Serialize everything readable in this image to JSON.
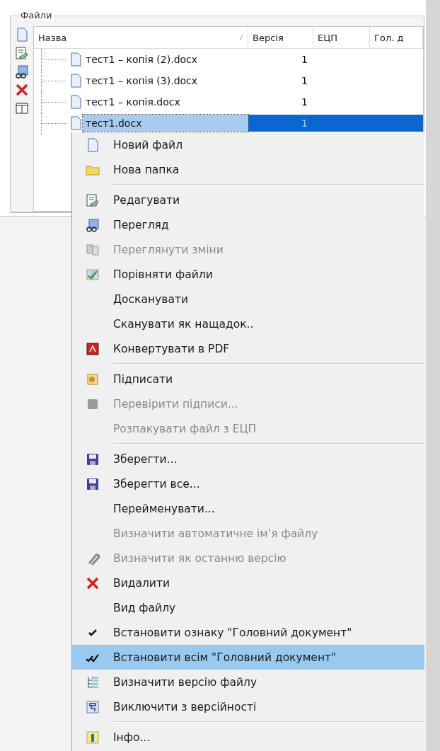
{
  "panel": {
    "title": "Файли"
  },
  "table": {
    "columns": [
      "Назва",
      "Версія",
      "ЕЦП",
      "Гол. д"
    ],
    "rows": [
      {
        "name": "тест1 – копія (2).docx",
        "version": "1",
        "selected": false
      },
      {
        "name": "тест1 – копія (3).docx",
        "version": "1",
        "selected": false
      },
      {
        "name": "тест1 – копія.docx",
        "version": "1",
        "selected": false
      },
      {
        "name": "тест1.docx",
        "version": "1",
        "selected": true
      }
    ]
  },
  "menu": {
    "groups": [
      [
        {
          "label": "Новий файл",
          "disabled": false,
          "selected": false
        },
        {
          "label": "Нова папка",
          "disabled": false,
          "selected": false
        }
      ],
      [
        {
          "label": "Редагувати",
          "disabled": false,
          "selected": false
        },
        {
          "label": "Перегляд",
          "disabled": false,
          "selected": false
        },
        {
          "label": "Переглянути зміни",
          "disabled": true,
          "selected": false
        },
        {
          "label": "Порівняти файли",
          "disabled": false,
          "selected": false
        },
        {
          "label": "Досканувати",
          "disabled": false,
          "selected": false
        },
        {
          "label": "Сканувати як нащадок..",
          "disabled": false,
          "selected": false
        },
        {
          "label": "Конвертувати в PDF",
          "disabled": false,
          "selected": false
        }
      ],
      [
        {
          "label": "Підписати",
          "disabled": false,
          "selected": false
        },
        {
          "label": "Перевірити підписи...",
          "disabled": true,
          "selected": false
        },
        {
          "label": "Розпакувати файл з ЕЦП",
          "disabled": true,
          "selected": false
        }
      ],
      [
        {
          "label": "Зберегти...",
          "disabled": false,
          "selected": false
        },
        {
          "label": "Зберегти все...",
          "disabled": false,
          "selected": false
        },
        {
          "label": "Перейменувати...",
          "disabled": false,
          "selected": false
        },
        {
          "label": "Визначити автоматичне ім'я файлу",
          "disabled": true,
          "selected": false
        },
        {
          "label": "Визначити як останню версію",
          "disabled": true,
          "selected": false
        },
        {
          "label": "Видалити",
          "disabled": false,
          "selected": false
        },
        {
          "label": "Вид файлу",
          "disabled": false,
          "selected": false
        },
        {
          "label": "Встановити ознаку \"Головний документ\"",
          "disabled": false,
          "selected": false
        },
        {
          "label": "Встановити всім \"Головний документ\"",
          "disabled": false,
          "selected": true
        },
        {
          "label": "Визначити версію файлу",
          "disabled": false,
          "selected": false
        },
        {
          "label": "Виключити з версійності",
          "disabled": false,
          "selected": false
        }
      ],
      [
        {
          "label": "Інфо...",
          "disabled": false,
          "selected": false
        }
      ]
    ]
  }
}
